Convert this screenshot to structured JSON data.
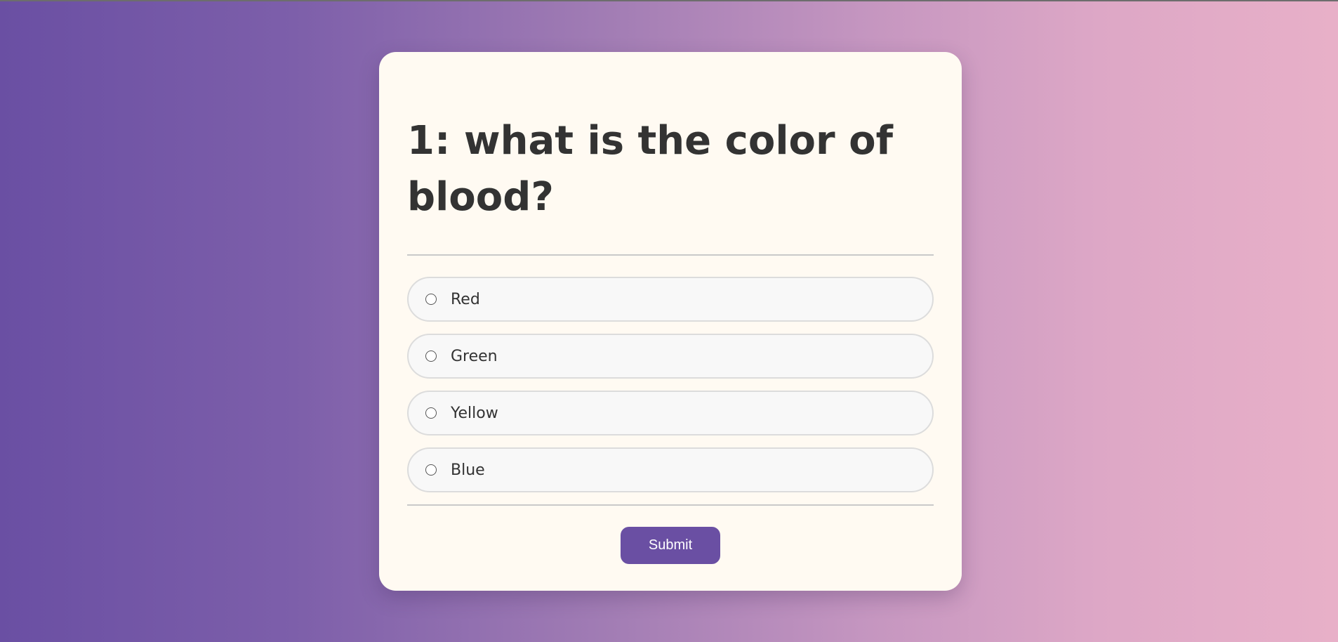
{
  "quiz": {
    "question": "1: what is the color of blood?",
    "options": [
      {
        "label": "Red",
        "selected": false
      },
      {
        "label": "Green",
        "selected": false
      },
      {
        "label": "Yellow",
        "selected": false
      },
      {
        "label": "Blue",
        "selected": false
      }
    ],
    "submit_label": "Submit"
  },
  "colors": {
    "accent": "#6a4fa3",
    "card_background": "#fffaf2",
    "text": "#333333"
  }
}
